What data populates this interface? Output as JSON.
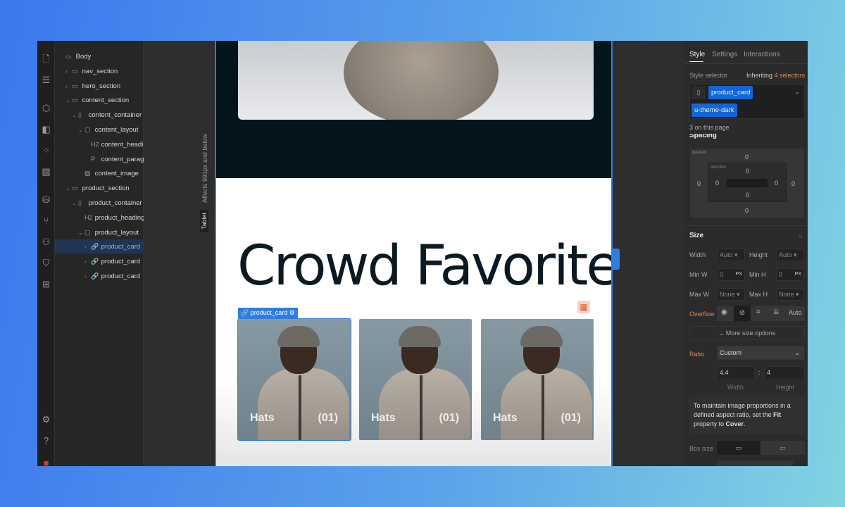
{
  "navigator": {
    "items": [
      {
        "label": "Body",
        "icon": "body-icon",
        "indent": 0,
        "caret": ""
      },
      {
        "label": "nav_section",
        "icon": "section-icon",
        "indent": 1,
        "caret": ">"
      },
      {
        "label": "hero_section",
        "icon": "section-icon",
        "indent": 1,
        "caret": ">"
      },
      {
        "label": "content_section",
        "icon": "section-icon",
        "indent": 1,
        "caret": "v"
      },
      {
        "label": "content_container",
        "icon": "container-icon",
        "indent": 2,
        "caret": "v"
      },
      {
        "label": "content_layout",
        "icon": "div-icon",
        "indent": 3,
        "caret": "v"
      },
      {
        "label": "content_heading",
        "icon": "H2",
        "indent": 4,
        "caret": ""
      },
      {
        "label": "content_paragra...",
        "icon": "P",
        "indent": 4,
        "caret": ""
      },
      {
        "label": "content_image",
        "icon": "image-icon",
        "indent": 3,
        "caret": ""
      },
      {
        "label": "product_section",
        "icon": "section-icon",
        "indent": 1,
        "caret": "v"
      },
      {
        "label": "product_container",
        "icon": "container-icon",
        "indent": 2,
        "caret": "v"
      },
      {
        "label": "product_heading",
        "icon": "H2",
        "indent": 3,
        "caret": ""
      },
      {
        "label": "product_layout",
        "icon": "div-icon",
        "indent": 3,
        "caret": "v"
      },
      {
        "label": "product_card",
        "icon": "link-icon",
        "indent": 4,
        "caret": ">",
        "selected": true
      },
      {
        "label": "product_card",
        "icon": "link-icon",
        "indent": 4,
        "caret": ">"
      },
      {
        "label": "product_card",
        "icon": "link-icon",
        "indent": 4,
        "caret": ">"
      }
    ]
  },
  "breakpoint": {
    "note": "Affects 991px and below",
    "name": "Tablet"
  },
  "canvas": {
    "heading": "Crowd Favorites",
    "selected_tag": "product_card",
    "cards": [
      {
        "title": "Hats",
        "count": "(01)"
      },
      {
        "title": "Hats",
        "count": "(01)"
      },
      {
        "title": "Hats",
        "count": "(01)"
      }
    ]
  },
  "panel": {
    "tabs": [
      "Style",
      "Settings",
      "Interactions"
    ],
    "style_selector_label": "Style selector",
    "inheriting": "Inheriting",
    "inheriting_count": "4 selectors",
    "chips": [
      "product_card",
      "u-theme-dark"
    ],
    "on_page": "3 on this page",
    "spacing": {
      "title": "Spacing",
      "margin_label": "MARGIN",
      "padding_label": "PADDING",
      "margin": [
        "0",
        "0",
        "0",
        "0"
      ],
      "padding": [
        "0",
        "0",
        "0",
        "0"
      ]
    },
    "size": {
      "title": "Size",
      "width_label": "Width",
      "width": "Auto",
      "height_label": "Height",
      "height": "Auto",
      "minw_label": "Min W",
      "minw": "0",
      "minh_label": "Min H",
      "minh": "0",
      "unit": "PX",
      "maxw_label": "Max W",
      "maxw": "None",
      "maxh_label": "Max H",
      "maxh": "None",
      "overflow_label": "Overflow",
      "overflow_auto": "Auto",
      "more": "More size options",
      "ratio_label": "Ratio",
      "ratio": "Custom",
      "ratio_w": "4.4",
      "ratio_h": "4",
      "ratio_sep": ":",
      "w_caption": "Width",
      "h_caption": "Height",
      "info_pre": "To maintain image proportions in a defined aspect ratio, set the ",
      "info_fit": "Fit",
      "info_mid": " property to ",
      "info_cover": "Cover",
      "info_end": ".",
      "box_size_label": "Box size"
    }
  },
  "colors": {
    "accent": "#2f7de1",
    "orange": "#e2894f"
  }
}
